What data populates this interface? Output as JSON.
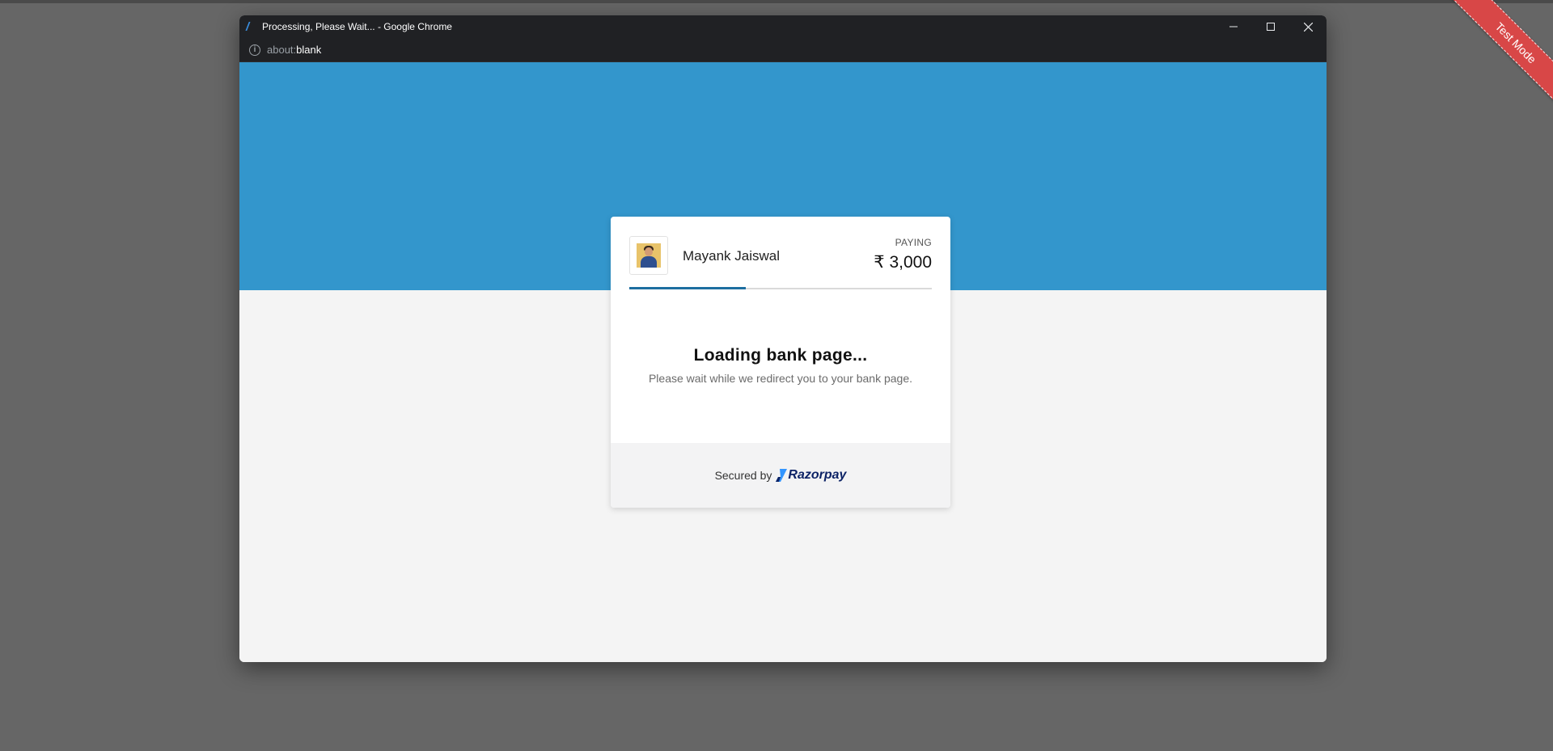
{
  "ribbon": {
    "label": "Test Mode"
  },
  "window": {
    "title": "Processing, Please Wait... - Google Chrome",
    "favicon": "razorpay-favicon",
    "url_scheme": "about:",
    "url_host": "blank"
  },
  "merchant": {
    "name": "Mayank Jaiswal"
  },
  "payment": {
    "label": "PAYING",
    "amount": "₹ 3,000",
    "progress_fraction": 0.385
  },
  "status": {
    "title": "Loading bank page...",
    "subtitle": "Please wait while we redirect you to your bank page."
  },
  "footer": {
    "secured_label": "Secured by",
    "brand": "Razorpay"
  },
  "colors": {
    "header_blue": "#3396cc",
    "progress_blue": "#1d6ea0",
    "ribbon_red": "#d84747",
    "brand_navy": "#0d2366"
  }
}
